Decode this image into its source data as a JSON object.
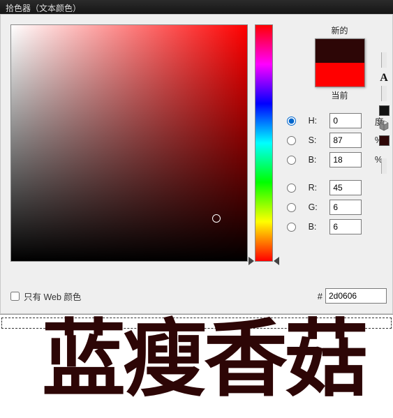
{
  "window": {
    "title": "拾色器（文本颜色）"
  },
  "preview": {
    "new_label": "新的",
    "current_label": "当前",
    "new_color": "#2d0606",
    "current_color": "#ff0000"
  },
  "hsb": {
    "h": {
      "label": "H:",
      "value": "0",
      "unit": "度"
    },
    "s": {
      "label": "S:",
      "value": "87",
      "unit": "%"
    },
    "b": {
      "label": "B:",
      "value": "18",
      "unit": "%"
    }
  },
  "rgb": {
    "r": {
      "label": "R:",
      "value": "45"
    },
    "g": {
      "label": "G:",
      "value": "6"
    },
    "b": {
      "label": "B:",
      "value": "6"
    }
  },
  "hex": {
    "hash": "#",
    "value": "2d0606"
  },
  "web_only": {
    "label": "只有 Web 颜色",
    "checked": false
  },
  "sv_marker": {
    "x_pct": 87,
    "y_pct": 82
  },
  "canvas_text": "蓝瘦香菇",
  "icons": {
    "warning": "A",
    "swatch": "swatch-icon",
    "cube": "cube-icon",
    "small_swatch": "small-swatch-icon"
  }
}
